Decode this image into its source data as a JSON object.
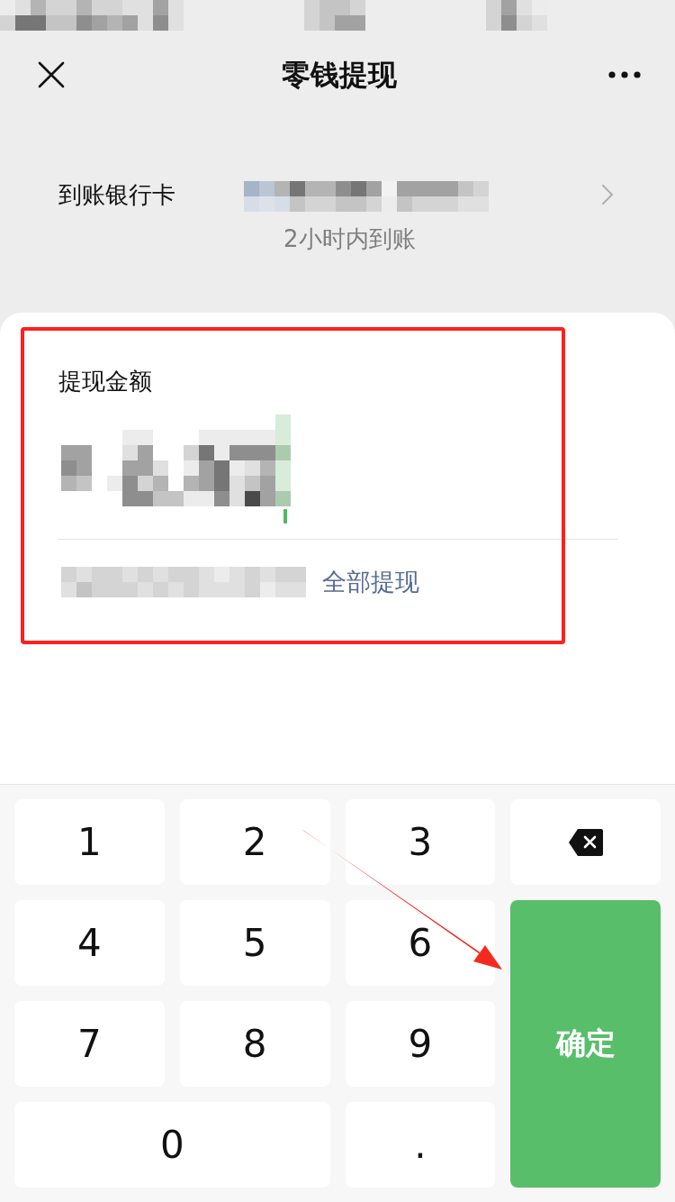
{
  "nav": {
    "title": "零钱提现"
  },
  "bank_row": {
    "label": "到账银行卡",
    "note": "2小时内到账"
  },
  "amount_panel": {
    "label": "提现金额",
    "withdraw_all_link": "全部提现"
  },
  "keypad": {
    "keys": [
      {
        "kind": "digit",
        "label": "1"
      },
      {
        "kind": "digit",
        "label": "2"
      },
      {
        "kind": "digit",
        "label": "3"
      },
      {
        "kind": "backspace"
      },
      {
        "kind": "digit",
        "label": "4"
      },
      {
        "kind": "digit",
        "label": "5"
      },
      {
        "kind": "digit",
        "label": "6"
      },
      {
        "kind": "digit",
        "label": "7"
      },
      {
        "kind": "digit",
        "label": "8"
      },
      {
        "kind": "digit",
        "label": "9"
      },
      {
        "kind": "wide_digit",
        "label": "0"
      },
      {
        "kind": "digit",
        "label": "."
      },
      {
        "kind": "confirm",
        "label": "确定"
      }
    ]
  },
  "annotations": {
    "highlight_frame": true,
    "arrow": true
  }
}
